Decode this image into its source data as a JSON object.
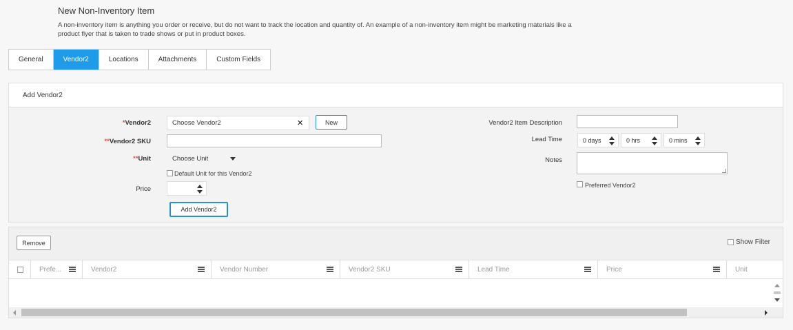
{
  "page": {
    "title": "New Non-Inventory Item",
    "description": "A non-inventory item is anything you order or receive, but do not want to track the location and quantity of. An example of a non-inventory item might be marketing materials like a product flyer that is taken to trade shows or put in product boxes."
  },
  "tabs": [
    {
      "label": "General",
      "active": false
    },
    {
      "label": "Vendor2",
      "active": true
    },
    {
      "label": "Locations",
      "active": false
    },
    {
      "label": "Attachments",
      "active": false
    },
    {
      "label": "Custom Fields",
      "active": false
    }
  ],
  "form": {
    "header": "Add Vendor2",
    "vendor_label": "Vendor2",
    "vendor_star": "*",
    "vendor_placeholder": "Choose Vendor2",
    "clear_icon": "×",
    "new_button": "New",
    "sku_label": "Vendor2 SKU",
    "sku_star": "**",
    "sku_value": "",
    "unit_label": "Unit",
    "unit_star": "**",
    "unit_placeholder": "Choose Unit",
    "default_unit_label": "Default Unit for this Vendor2",
    "price_label": "Price",
    "price_value": "",
    "add_button": "Add Vendor2",
    "item_desc_label": "Vendor2 Item Description",
    "item_desc_value": "",
    "lead_time_label": "Lead Time",
    "lead_days": "0 days",
    "lead_hrs": "0 hrs",
    "lead_mins": "0 mins",
    "notes_label": "Notes",
    "notes_value": "",
    "preferred_label": "Preferred Vendor2"
  },
  "grid": {
    "remove_button": "Remove",
    "show_filter_label": "Show Filter",
    "columns": [
      "Prefe...",
      "Vendor2",
      "Vendor Number",
      "Vendor2 SKU",
      "Lead Time",
      "Price",
      "Unit"
    ]
  },
  "colors": {
    "accent": "#1e9cea",
    "required": "#d9534f",
    "button_border": "#2a8fd0"
  }
}
